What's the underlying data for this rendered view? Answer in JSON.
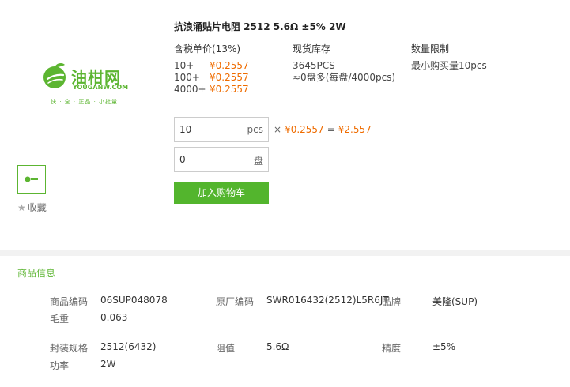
{
  "product": {
    "title": "抗浪涌贴片电阻 2512 5.6Ω ±5% 2W"
  },
  "logo": {
    "brand_cn": "油柑网",
    "brand_en": "YOUGANW.COM",
    "slogan": "快 · 全 · 正品 · 小批量"
  },
  "favorite": {
    "label": "收藏"
  },
  "pricing": {
    "header": "含税单价(13%)",
    "tiers": [
      {
        "qty": "10+",
        "price": "¥0.2557"
      },
      {
        "qty": "100+",
        "price": "¥0.2557"
      },
      {
        "qty": "4000+",
        "price": "¥0.2557"
      }
    ]
  },
  "stock": {
    "header": "现货库存",
    "count": "3645PCS",
    "reels": "≈0盘多(每盘/4000pcs)"
  },
  "limit": {
    "header": "数量限制",
    "min": "最小购买量10pcs"
  },
  "order": {
    "qty_value": "10",
    "qty_unit": "pcs",
    "reel_value": "0",
    "reel_unit": "盘",
    "multiply": "×",
    "unit_price": "¥0.2557",
    "equals": "=",
    "total": "¥2.557",
    "cart_label": "加入购物车"
  },
  "info": {
    "section_title": "商品信息",
    "fields": {
      "code_label": "商品编码",
      "code_value": "06SUP048078",
      "mfr_label": "原厂编码",
      "mfr_value": "SWR016432(2512)L5R6JT",
      "brand_label": "品牌",
      "brand_value": "美隆(SUP)",
      "weight_label": "毛重",
      "weight_value": "0.063",
      "package_label": "封装规格",
      "package_value": "2512(6432)",
      "resist_label": "阻值",
      "resist_value": "5.6Ω",
      "tol_label": "精度",
      "tol_value": "±5%",
      "power_label": "功率",
      "power_value": "2W"
    }
  },
  "colors": {
    "accent": "#5cb531",
    "price": "#ef6c00",
    "button": "#53b52d"
  }
}
